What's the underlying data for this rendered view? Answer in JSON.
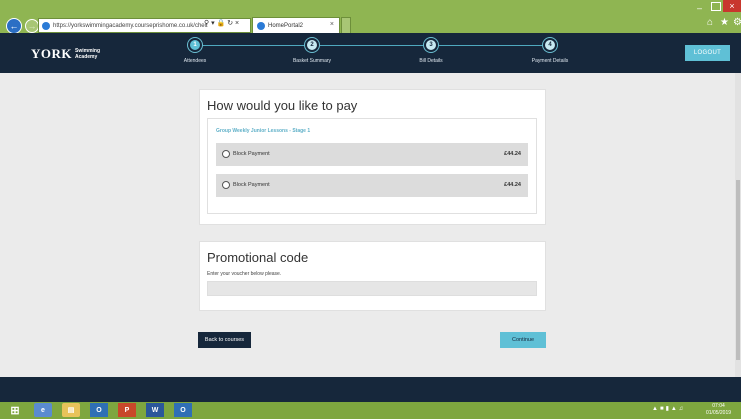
{
  "browser": {
    "url": "https://yorkswimmingacademy.courseprishome.co.uk/chec",
    "url_domain": "courseprishome.co.uk",
    "tab_title": "HomePortal2"
  },
  "site": {
    "logo_mark": "ORK",
    "logo_sub_1": "Swimming",
    "logo_sub_2": "Academy",
    "logout_label": "LOGOUT"
  },
  "steps": [
    {
      "num": "1",
      "label": "Attendees",
      "active": true
    },
    {
      "num": "2",
      "label": "Basket Summary",
      "active": false
    },
    {
      "num": "3",
      "label": "Bill Details",
      "active": false
    },
    {
      "num": "4",
      "label": "Payment Details",
      "active": false
    }
  ],
  "payment": {
    "title": "How would you like to pay",
    "course": "Group Weekly Junior Lessons - Stage 1",
    "options": [
      {
        "label": "Block Payment",
        "price": "£44.24"
      },
      {
        "label": "Block Payment",
        "price": "£44.24"
      }
    ]
  },
  "promo": {
    "title": "Promotional code",
    "help": "Enter your voucher below please.",
    "voucher_value": ""
  },
  "actions": {
    "back_label": "Back to courses",
    "continue_label": "Continue"
  },
  "taskbar": {
    "time": "07:04",
    "date": "01/05/2019"
  },
  "colors": {
    "chrome": "#8fb552",
    "header": "#16273b",
    "accent": "#5fc0d6"
  }
}
